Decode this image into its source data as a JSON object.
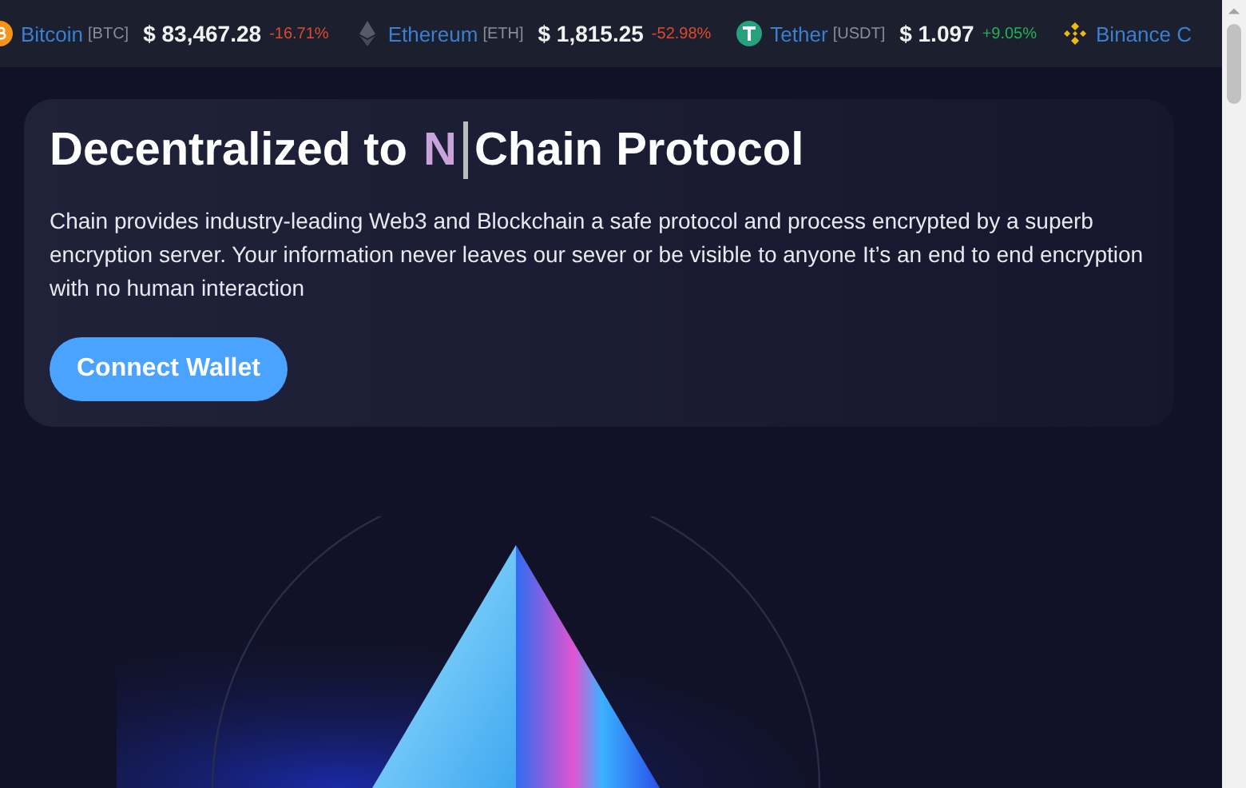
{
  "ticker": [
    {
      "kind": "bitcoin",
      "name": "Bitcoin",
      "symbol": "[BTC]",
      "price": "$ 83,467.28",
      "change": "-16.71%",
      "color": "#e0492c"
    },
    {
      "kind": "ethereum",
      "name": "Ethereum",
      "symbol": "[ETH]",
      "price": "$ 1,815.25",
      "change": "-52.98%",
      "color": "#e0492c"
    },
    {
      "kind": "tether",
      "name": "Tether",
      "symbol": "[USDT]",
      "price": "$ 1.097",
      "change": "+9.05%",
      "color": "#21b35a"
    },
    {
      "kind": "binance",
      "name": "Binance C"
    }
  ],
  "hero": {
    "heading_before": "Decentralized to",
    "typed": "N",
    "heading_after": "Chain Protocol",
    "description": "Chain provides industry-leading Web3 and Blockchain a safe protocol and process encrypted by a superb encryption server. Your information never leaves our sever or be visible to anyone It’s an end to end encryption with no human interaction",
    "button": "Connect Wallet"
  }
}
